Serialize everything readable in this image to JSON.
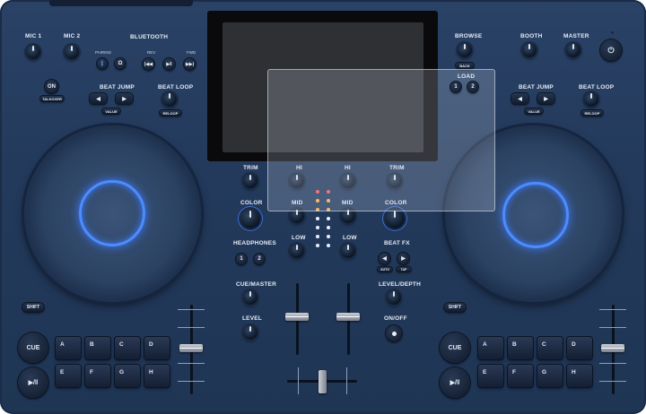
{
  "left_deck": {
    "mic1": "MIC 1",
    "mic2": "MIC 2",
    "bluetooth": "BLUETOOTH",
    "pairing": "PAIRING",
    "rev": "REV",
    "fwd": "FWD",
    "on": "ON",
    "talkover": "TALKOVER",
    "beat_jump": "BEAT JUMP",
    "beat_loop": "BEAT LOOP",
    "value": "VALUE",
    "reloop": "RELOOP",
    "shift": "SHIFT",
    "cue": "CUE",
    "pads_top": [
      "A",
      "B",
      "C",
      "D"
    ],
    "pads_bottom": [
      "E",
      "F",
      "G",
      "H"
    ]
  },
  "right_deck": {
    "browse": "BROWSE",
    "back": "BACK",
    "booth": "BOOTH",
    "master": "MASTER",
    "load": "LOAD",
    "load_buttons": [
      "1",
      "2"
    ],
    "beat_jump": "BEAT JUMP",
    "beat_loop": "BEAT LOOP",
    "value": "VALUE",
    "reloop": "RELOOP",
    "shift": "SHIFT",
    "cue": "CUE",
    "pads_top": [
      "A",
      "B",
      "C",
      "D"
    ],
    "pads_bottom": [
      "E",
      "F",
      "G",
      "H"
    ]
  },
  "mixer": {
    "trim": "TRIM",
    "hi": "HI",
    "mid": "MID",
    "low": "LOW",
    "color": "COLOR",
    "headphones": "HEADPHONES",
    "hp_buttons": [
      "1",
      "2"
    ],
    "beat_fx": "BEAT FX",
    "auto": "AUTO",
    "tap": "TAP",
    "cue_master": "CUE/MASTER",
    "level": "LEVEL",
    "level_depth": "LEVEL/DEPTH",
    "on_off": "ON/OFF"
  },
  "colors": {
    "body": "#233a5c",
    "jog_ring": "#4d8cff",
    "bluetooth_led": "#3b7bff",
    "meter_red": "#ff5a5a",
    "meter_amber": "#ffb347",
    "meter_green": "#e8f0ff"
  }
}
